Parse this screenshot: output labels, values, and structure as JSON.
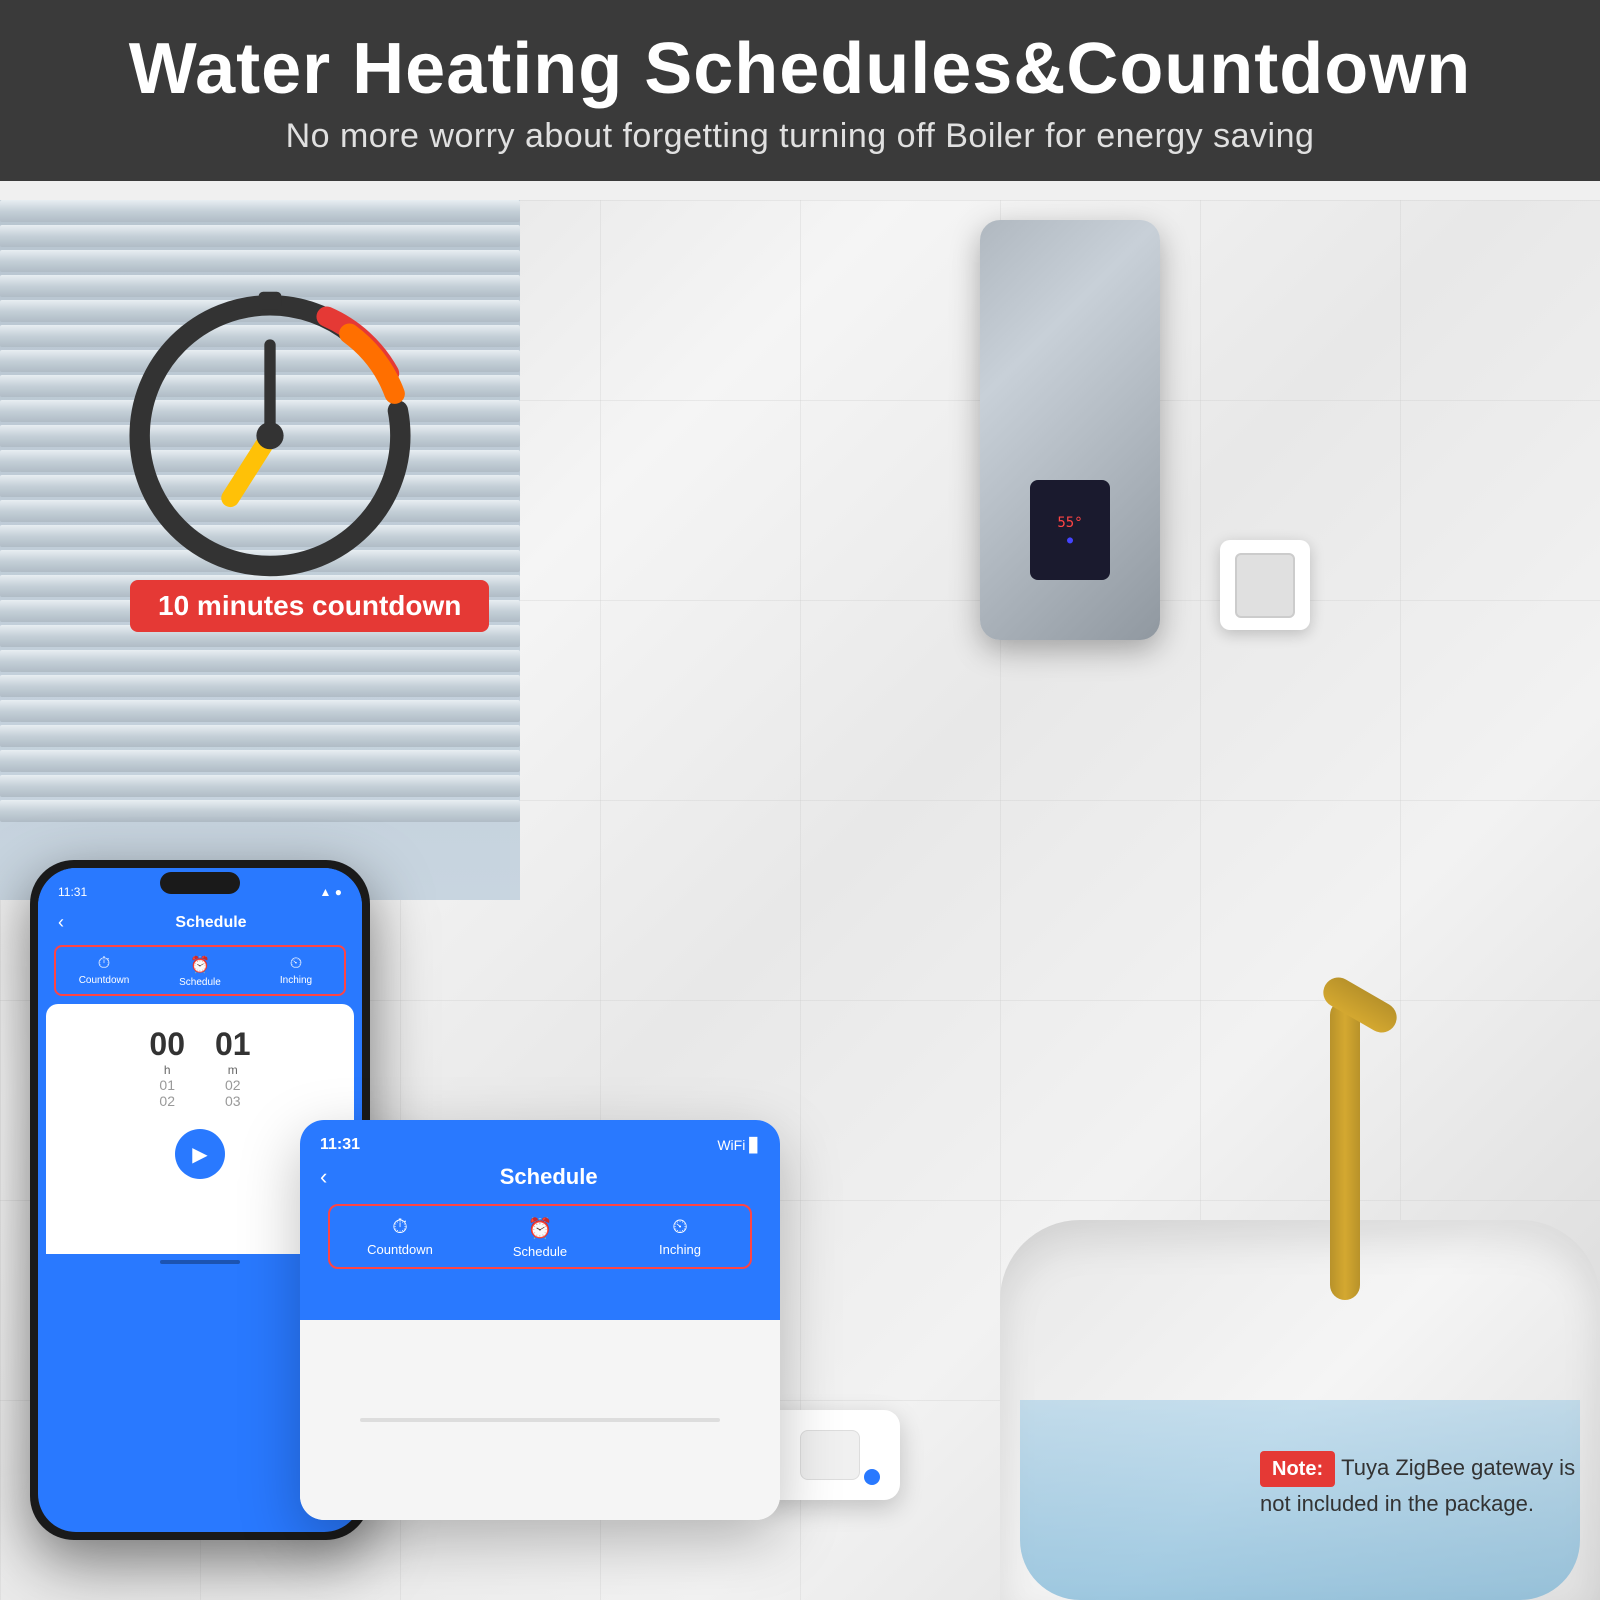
{
  "header": {
    "title": "Water Heating Schedules&Countdown",
    "subtitle": "No more worry about forgetting turning off Boiler for energy saving"
  },
  "badge": {
    "text": "10 minutes countdown"
  },
  "app": {
    "time": "11:31",
    "title": "Schedule",
    "back_icon": "‹",
    "tabs": [
      {
        "label": "Countdown",
        "icon": "⏱"
      },
      {
        "label": "Schedule",
        "icon": "⏰"
      },
      {
        "label": "Inching",
        "icon": "⏲"
      }
    ],
    "hours_label": "h",
    "minutes_label": "m",
    "hours_value": "00",
    "minutes_value": "01",
    "hours_sub1": "01",
    "hours_sub2": "02",
    "minutes_sub1": "02",
    "minutes_sub2": "03",
    "play_icon": "▶"
  },
  "note": {
    "label": "Note:",
    "text": "Tuya ZigBee gateway is not included in the package."
  },
  "wifi_icon": "WiFi",
  "battery_icon": "▊"
}
